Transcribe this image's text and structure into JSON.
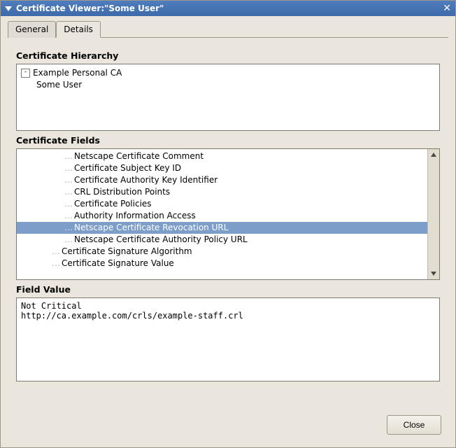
{
  "window": {
    "title": "Certificate Viewer:\"Some User\""
  },
  "tabs": {
    "general": "General",
    "details": "Details",
    "active": "details"
  },
  "sections": {
    "hierarchy_label": "Certificate Hierarchy",
    "fields_label": "Certificate Fields",
    "value_label": "Field Value"
  },
  "hierarchy": {
    "root": "Example Personal CA",
    "child": "Some User"
  },
  "fields": [
    {
      "indent": 3,
      "label": "Netscape Certificate Comment",
      "selected": false
    },
    {
      "indent": 3,
      "label": "Certificate Subject Key ID",
      "selected": false
    },
    {
      "indent": 3,
      "label": "Certificate Authority Key Identifier",
      "selected": false
    },
    {
      "indent": 3,
      "label": "CRL Distribution Points",
      "selected": false
    },
    {
      "indent": 3,
      "label": "Certificate Policies",
      "selected": false
    },
    {
      "indent": 3,
      "label": "Authority Information Access",
      "selected": false
    },
    {
      "indent": 3,
      "label": "Netscape Certificate Revocation URL",
      "selected": true
    },
    {
      "indent": 3,
      "label": "Netscape Certificate Authority Policy URL",
      "selected": false
    },
    {
      "indent": 2,
      "label": "Certificate Signature Algorithm",
      "selected": false
    },
    {
      "indent": 2,
      "label": "Certificate Signature Value",
      "selected": false
    }
  ],
  "field_value": "Not Critical\nhttp://ca.example.com/crls/example-staff.crl",
  "buttons": {
    "close": "Close"
  }
}
